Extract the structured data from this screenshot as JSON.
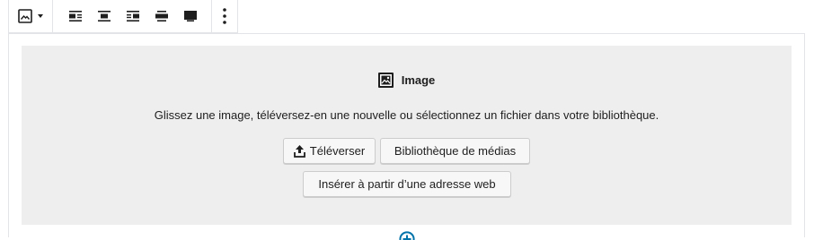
{
  "toolbar": {
    "change_block_type_icon": "image-icon",
    "dropdown_icon": "caret-down-icon",
    "alignment_icons": [
      "align-left-icon",
      "align-center-icon",
      "align-right-icon",
      "align-wide-icon",
      "align-full-icon"
    ],
    "more_options_icon": "vertical-ellipsis-icon"
  },
  "placeholder": {
    "icon": "image-icon",
    "title": "Image",
    "instructions": "Glissez une image, téléversez-en une nouvelle ou sélectionnez un fichier dans votre bibliothèque.",
    "upload_icon": "upload-icon",
    "upload_label": "Téléverser",
    "library_label": "Bibliothèque de médias",
    "url_label": "Insérer à partir d’une adresse web"
  },
  "inserter": {
    "icon": "plus-circle-icon"
  },
  "colors": {
    "accent": "#0073aa",
    "placeholder_bg": "#eeeeee",
    "border": "#e2e4e7",
    "icon": "#1e1e1e"
  }
}
